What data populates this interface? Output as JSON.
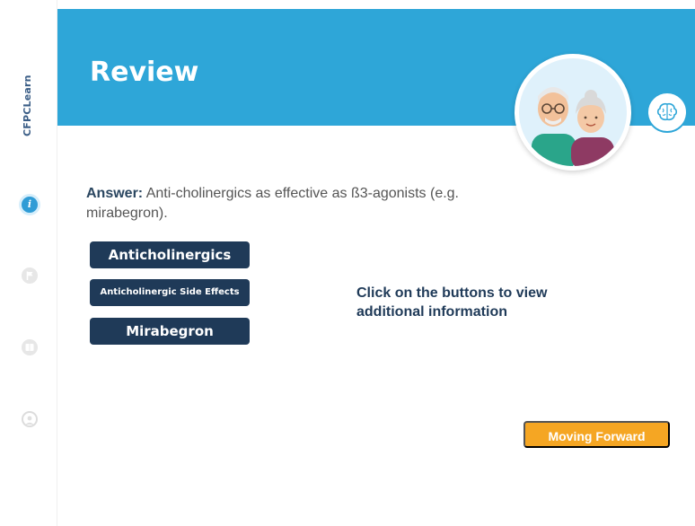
{
  "sidebar": {
    "logo_text": "CFPCLearn",
    "items": [
      {
        "name": "info",
        "glyph": "i",
        "active": true
      },
      {
        "name": "flag",
        "active": false
      },
      {
        "name": "book",
        "active": false
      },
      {
        "name": "person",
        "active": false
      }
    ]
  },
  "header": {
    "title": "Review"
  },
  "content": {
    "answer_lead": "Answer:",
    "answer_text": " Anti-cholinergics as effective as ß3-agonists (e.g. mirabegron).",
    "buttons": [
      {
        "label": "Anticholinergics"
      },
      {
        "label": "Anticholinergic Side Effects"
      },
      {
        "label": "Mirabegron"
      }
    ],
    "instruction": "Click on the buttons to view additional information",
    "forward_label": "Moving Forward"
  },
  "colors": {
    "banner": "#2ea6d8",
    "button": "#1f3a58",
    "forward": "#f5a623",
    "active_icon": "#2f9cd6"
  }
}
